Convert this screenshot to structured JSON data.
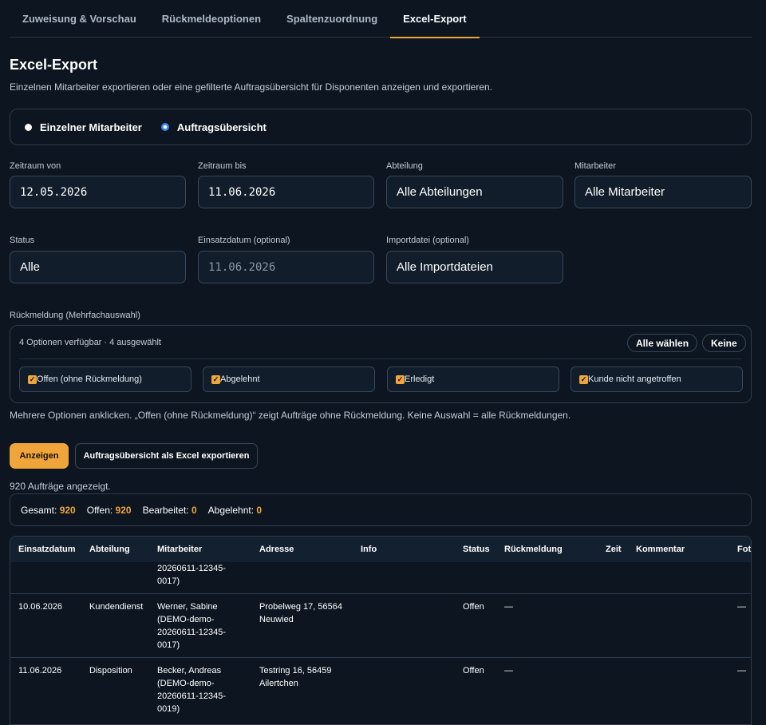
{
  "tabs": [
    "Zuweisung & Vorschau",
    "Rückmeldeoptionen",
    "Spaltenzuordnung",
    "Excel-Export"
  ],
  "active_tab": 3,
  "page": {
    "title": "Excel-Export",
    "subtitle": "Einzelnen Mitarbeiter exportieren oder eine gefilterte Auftragsübersicht für Disponenten anzeigen und exportieren."
  },
  "mode": {
    "option_single": "Einzelner Mitarbeiter",
    "option_overview": "Auftragsübersicht",
    "selected": "Auftragsübersicht"
  },
  "filters": {
    "zeitraum_von": {
      "label": "Zeitraum von",
      "value": "12.05.2026"
    },
    "zeitraum_bis": {
      "label": "Zeitraum bis",
      "value": "11.06.2026"
    },
    "abteilung": {
      "label": "Abteilung",
      "value": "Alle Abteilungen"
    },
    "mitarbeiter": {
      "label": "Mitarbeiter",
      "value": "Alle Mitarbeiter"
    },
    "status": {
      "label": "Status",
      "value": "Alle"
    },
    "einsatzdatum": {
      "label": "Einsatzdatum (optional)",
      "placeholder": "11.06.2026"
    },
    "importdatei": {
      "label": "Importdatei (optional)",
      "value": "Alle Importdateien"
    }
  },
  "rueckmeldung": {
    "label": "Rückmeldung (Mehrfachauswahl)",
    "info": "4 Optionen verfügbar · 4 ausgewählt",
    "select_all": "Alle wählen",
    "select_none": "Keine",
    "options": [
      "Offen (ohne Rückmeldung)",
      "Abgelehnt",
      "Erledigt",
      "Kunde nicht angetroffen"
    ],
    "hint": "Mehrere Optionen anklicken. „Offen (ohne Rückmeldung)“ zeigt Aufträge ohne Rückmeldung. Keine Auswahl = alle Rückmeldungen."
  },
  "actions": {
    "show": "Anzeigen",
    "export": "Auftragsübersicht als Excel exportieren"
  },
  "result_count": "920 Aufträge angezeigt.",
  "stats": {
    "gesamt_label": "Gesamt:",
    "gesamt": "920",
    "offen_label": "Offen:",
    "offen": "920",
    "bearbeitet_label": "Bearbeitet:",
    "bearbeitet": "0",
    "abgelehnt_label": "Abgelehnt:",
    "abgelehnt": "0"
  },
  "table": {
    "columns": [
      "Einsatzdatum",
      "Abteilung",
      "Mitarbeiter",
      "Adresse",
      "Info",
      "Status",
      "Rückmeldung",
      "Zeit",
      "Kommentar",
      "Fot"
    ],
    "partial_row": {
      "mitarbeiter": "20260611-12345-\n0017)"
    },
    "rows": [
      {
        "einsatzdatum": "10.06.2026",
        "abteilung": "Kundendienst",
        "mitarbeiter": "Werner, Sabine\n(DEMO-demo-\n20260611-12345-\n0017)",
        "adresse": "Probelweg 17, 56564\nNeuwied",
        "info": "",
        "status": "Offen",
        "rueckmeldung": "—",
        "zeit": "",
        "kommentar": "",
        "foto": "—"
      },
      {
        "einsatzdatum": "11.06.2026",
        "abteilung": "Disposition",
        "mitarbeiter": "Becker, Andreas\n(DEMO-demo-\n20260611-12345-\n0019)",
        "adresse": "Testring 16, 56459\nAilertchen",
        "info": "",
        "status": "Offen",
        "rueckmeldung": "—",
        "zeit": "",
        "kommentar": "",
        "foto": "—"
      }
    ]
  },
  "colors": {
    "accent": "#f0a53a",
    "radio": "#3b82f6",
    "background": "#0c1520"
  }
}
